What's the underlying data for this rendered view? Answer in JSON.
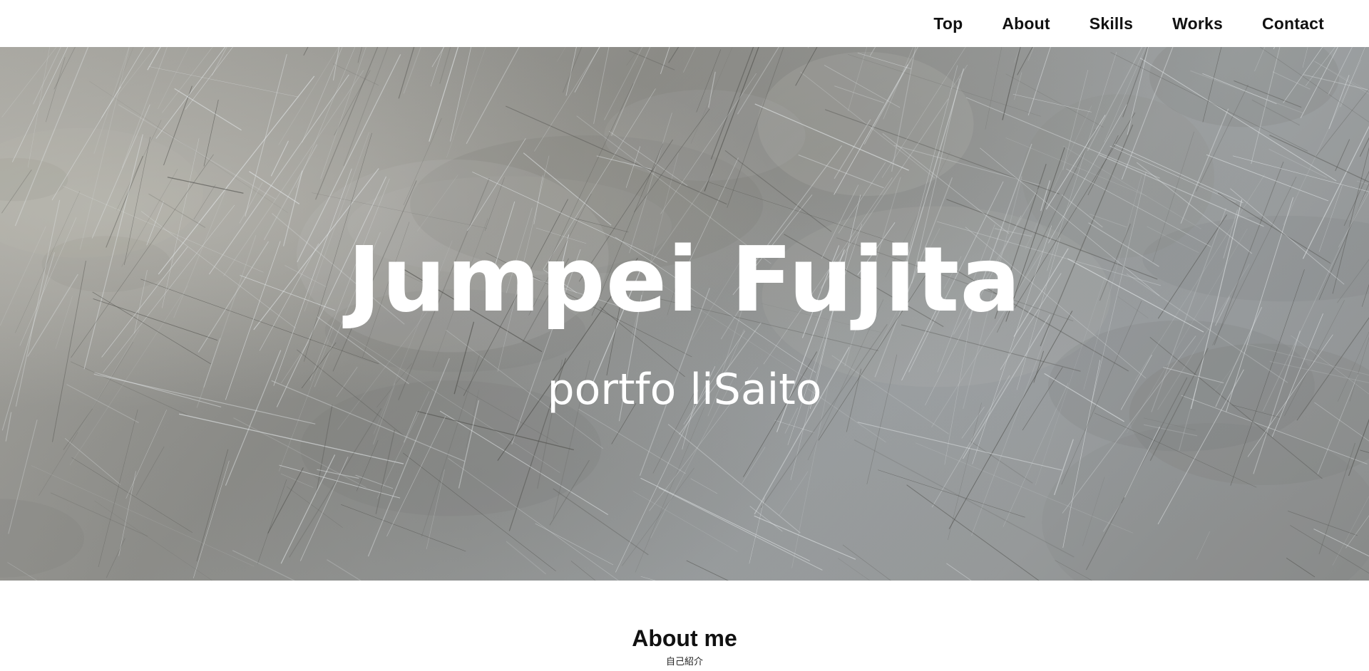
{
  "nav": {
    "items": [
      {
        "label": "Top"
      },
      {
        "label": "About"
      },
      {
        "label": "Skills"
      },
      {
        "label": "Works"
      },
      {
        "label": "Contact"
      }
    ]
  },
  "hero": {
    "title": "Jumpei Fujita",
    "subtitle": "portfo liSaito",
    "background": "scratched metal texture"
  },
  "about": {
    "heading": "About me",
    "subheading": "自己紹介"
  },
  "colors": {
    "header_bg": "#ffffff",
    "nav_text": "#111111",
    "hero_text": "#ffffff",
    "heading_text": "#111111"
  }
}
